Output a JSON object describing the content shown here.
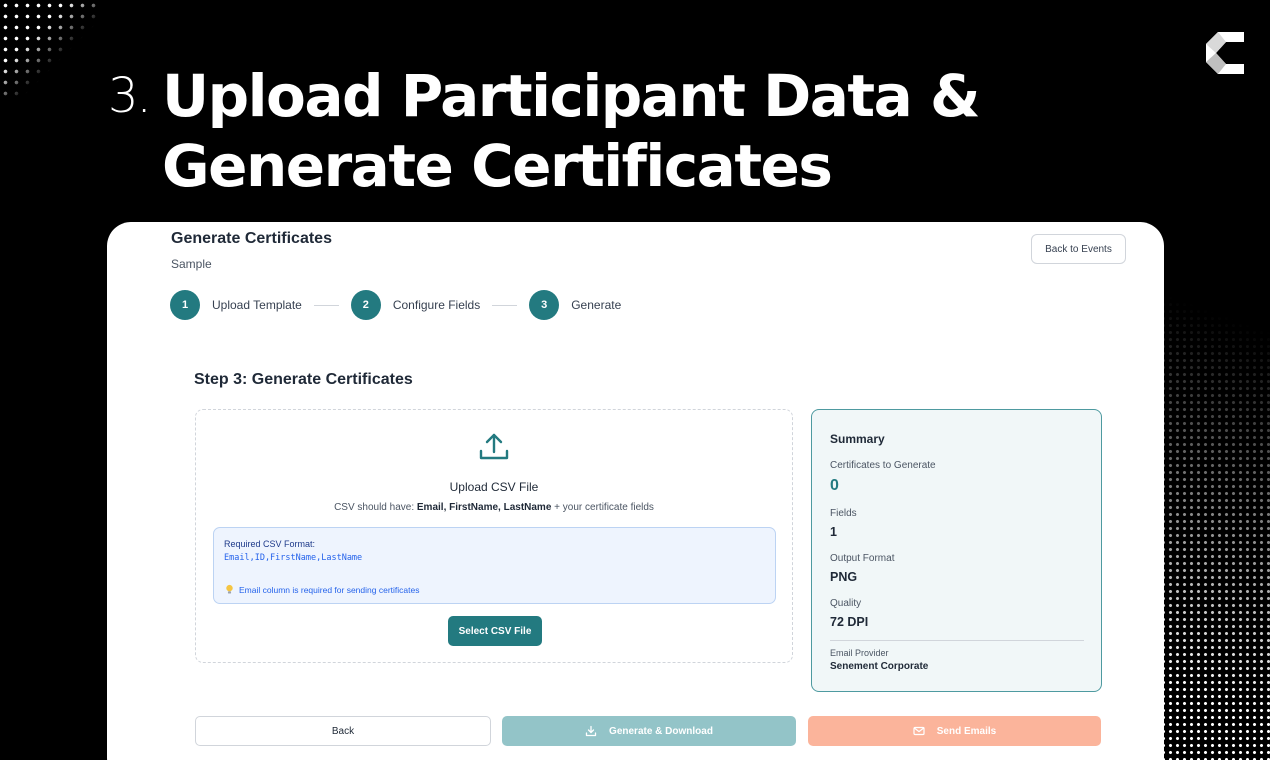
{
  "headline": {
    "number": "3.",
    "line1": "Upload Participant Data &",
    "line2": "Generate Certificates"
  },
  "header": {
    "title": "Generate Certificates",
    "subtitle": "Sample",
    "back_to_events": "Back to Events"
  },
  "stepper": {
    "steps": [
      {
        "number": "1",
        "label": "Upload Template"
      },
      {
        "number": "2",
        "label": "Configure Fields"
      },
      {
        "number": "3",
        "label": "Generate"
      }
    ]
  },
  "main": {
    "step_heading": "Step 3: Generate Certificates",
    "upload": {
      "title": "Upload CSV File",
      "hint_prefix": "CSV should have: ",
      "hint_fields": "Email, FirstName, LastName",
      "hint_suffix": " + your certificate fields",
      "format_label": "Required CSV Format:",
      "format_code": "Email,ID,FirstName,LastName",
      "format_note": "Email column is required for sending certificates",
      "select_button": "Select CSV File"
    }
  },
  "summary": {
    "title": "Summary",
    "items": [
      {
        "label": "Certificates to Generate",
        "value": "0"
      },
      {
        "label": "Fields",
        "value": "1"
      },
      {
        "label": "Output Format",
        "value": "PNG"
      },
      {
        "label": "Quality",
        "value": "72 DPI"
      }
    ],
    "email_provider_label": "Email Provider",
    "email_provider_value": "Senement Corporate"
  },
  "footer": {
    "back": "Back",
    "generate_download": "Generate & Download",
    "send_emails": "Send Emails"
  },
  "colors": {
    "accent": "#237a80",
    "generate_disabled": "#93c4c8",
    "send_disabled": "#fbb49b",
    "info_blue": "#2563eb"
  }
}
